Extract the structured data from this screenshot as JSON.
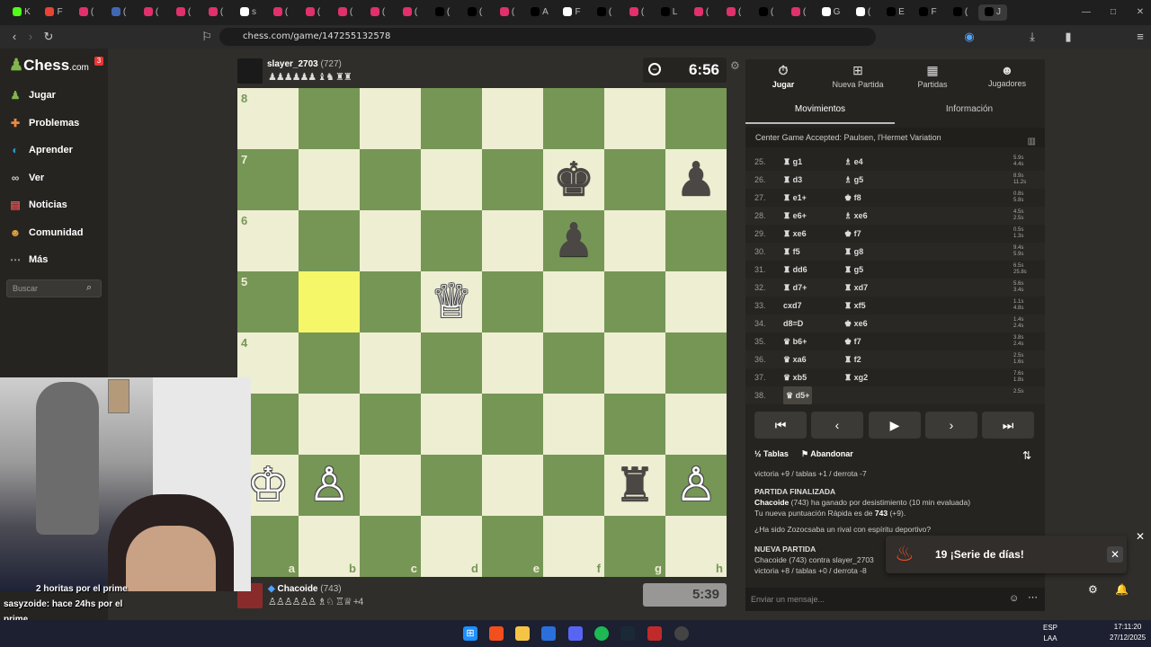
{
  "browser": {
    "url": "chess.com/game/147255132578",
    "tabs": [
      {
        "label": "K",
        "color": "#53fc18"
      },
      {
        "label": "F",
        "color": "#ea4335"
      },
      {
        "label": "(",
        "color": "#e1306c"
      },
      {
        "label": "(",
        "color": "#4267b2"
      },
      {
        "label": "(",
        "color": "#e1306c"
      },
      {
        "label": "(",
        "color": "#e1306c"
      },
      {
        "label": "(",
        "color": "#e1306c"
      },
      {
        "label": "s",
        "color": "#ffffff"
      },
      {
        "label": "(",
        "color": "#e1306c"
      },
      {
        "label": "(",
        "color": "#e1306c"
      },
      {
        "label": "(",
        "color": "#e1306c"
      },
      {
        "label": "(",
        "color": "#e1306c"
      },
      {
        "label": "(",
        "color": "#e1306c"
      },
      {
        "label": "(",
        "color": "#000000"
      },
      {
        "label": "(",
        "color": "#000000"
      },
      {
        "label": "(",
        "color": "#e1306c"
      },
      {
        "label": "A",
        "color": "#000000"
      },
      {
        "label": "F",
        "color": "#ffffff"
      },
      {
        "label": "(",
        "color": "#000000"
      },
      {
        "label": "(",
        "color": "#e1306c"
      },
      {
        "label": "L",
        "color": "#000000"
      },
      {
        "label": "(",
        "color": "#e1306c"
      },
      {
        "label": "(",
        "color": "#e1306c"
      },
      {
        "label": "(",
        "color": "#000000"
      },
      {
        "label": "(",
        "color": "#e1306c"
      },
      {
        "label": "G",
        "color": "#ffffff"
      },
      {
        "label": "(",
        "color": "#ffffff"
      },
      {
        "label": "E",
        "color": "#000000"
      },
      {
        "label": "F",
        "color": "#000000"
      },
      {
        "label": "(",
        "color": "#000000"
      },
      {
        "label": "J",
        "color": "#000000"
      }
    ]
  },
  "sidebar": {
    "logo": "Chess",
    "logo_suffix": ".com",
    "logo_badge": "3",
    "items": [
      {
        "label": "Jugar",
        "icon": "pawn-icon",
        "color": "#81b64c"
      },
      {
        "label": "Problemas",
        "icon": "puzzle-icon",
        "color": "#f0883a"
      },
      {
        "label": "Aprender",
        "icon": "learn-icon",
        "color": "#2d9ac9"
      },
      {
        "label": "Ver",
        "icon": "binoculars-icon",
        "color": "#cccccc"
      },
      {
        "label": "Noticias",
        "icon": "news-icon",
        "color": "#e05050"
      },
      {
        "label": "Comunidad",
        "icon": "community-icon",
        "color": "#e9a23b"
      },
      {
        "label": "Más",
        "icon": "more-icon",
        "color": "#999999"
      }
    ],
    "search_placeholder": "Buscar"
  },
  "top_player": {
    "name": "slayer_2703",
    "rating": "(727)",
    "captured": "♟♟♟♟♟♟ ♝♞ ♜♜",
    "clock": "6:56"
  },
  "bottom_player": {
    "name": "Chacoide",
    "rating": "(743)",
    "captured": "♙♙♙♙♙♙ ♗♘ ♖♕",
    "advantage": "+4",
    "clock": "5:39"
  },
  "board": {
    "highlight": [
      "b5"
    ],
    "pieces": [
      {
        "sq": "f7",
        "glyph": "♚",
        "color": "b"
      },
      {
        "sq": "h7",
        "glyph": "♟",
        "color": "b"
      },
      {
        "sq": "f6",
        "glyph": "♟",
        "color": "b"
      },
      {
        "sq": "d5",
        "glyph": "♕",
        "color": "w"
      },
      {
        "sq": "a2",
        "glyph": "♔",
        "color": "w"
      },
      {
        "sq": "b2",
        "glyph": "♙",
        "color": "w"
      },
      {
        "sq": "g2",
        "glyph": "♜",
        "color": "b"
      },
      {
        "sq": "h2",
        "glyph": "♙",
        "color": "w"
      }
    ],
    "ranks": [
      "8",
      "7",
      "6",
      "5",
      "4",
      "3",
      "2",
      "1"
    ],
    "files": [
      "a",
      "b",
      "c",
      "d",
      "e",
      "f",
      "g",
      "h"
    ]
  },
  "panel": {
    "tabs": [
      {
        "label": "Jugar",
        "icon": "stopwatch-icon"
      },
      {
        "label": "Nueva Partida",
        "icon": "plus-icon"
      },
      {
        "label": "Partidas",
        "icon": "board-icon"
      },
      {
        "label": "Jugadores",
        "icon": "players-icon"
      }
    ],
    "subtabs": [
      "Movimientos",
      "Información"
    ],
    "opening": "Center Game Accepted: Paulsen, l'Hermet Variation",
    "moves": [
      {
        "n": "25.",
        "w": "♜ g1",
        "b": "♗ e4",
        "t1": "5.9s",
        "t2": "4.4s"
      },
      {
        "n": "26.",
        "w": "♜ d3",
        "b": "♗ g5",
        "t1": "8.9s",
        "t2": "11.2s"
      },
      {
        "n": "27.",
        "w": "♜ e1+",
        "b": "♚ f8",
        "t1": "0.8s",
        "t2": "5.8s"
      },
      {
        "n": "28.",
        "w": "♜ e6+",
        "b": "♗ xe6",
        "t1": "4.5s",
        "t2": "2.5s"
      },
      {
        "n": "29.",
        "w": "♜ xe6",
        "b": "♚ f7",
        "t1": "0.5s",
        "t2": "1.3s"
      },
      {
        "n": "30.",
        "w": "♜ f5",
        "b": "♜ g8",
        "t1": "9.4s",
        "t2": "5.9s"
      },
      {
        "n": "31.",
        "w": "♜ dd6",
        "b": "♜ g5",
        "t1": "6.5s",
        "t2": "25.8s"
      },
      {
        "n": "32.",
        "w": "♜ d7+",
        "b": "♜ xd7",
        "t1": "5.6s",
        "t2": "3.4s"
      },
      {
        "n": "33.",
        "w": "cxd7",
        "b": "♜ xf5",
        "t1": "1.1s",
        "t2": "4.8s"
      },
      {
        "n": "34.",
        "w": "d8=D",
        "b": "♚ xe6",
        "t1": "1.4s",
        "t2": "2.4s"
      },
      {
        "n": "35.",
        "w": "♛ b6+",
        "b": "♚ f7",
        "t1": "3.8s",
        "t2": "2.4s"
      },
      {
        "n": "36.",
        "w": "♛ xa6",
        "b": "♜ f2",
        "t1": "2.5s",
        "t2": "1.6s"
      },
      {
        "n": "37.",
        "w": "♛ xb5",
        "b": "♜ xg2",
        "t1": "7.6s",
        "t2": "1.8s"
      },
      {
        "n": "38.",
        "w": "♛ d5+",
        "b": "",
        "t1": "2.5s",
        "t2": ""
      }
    ],
    "actions": {
      "draw": "Tablas",
      "resign": "Abandonar"
    },
    "chat": {
      "line1": "victoria +9 / tablas +1 / derrota -7",
      "finished_title": "PARTIDA FINALIZADA",
      "finished_player": "Chacoide",
      "finished_text": "(743) ha ganado por desistimiento (10 min evaluada)",
      "rating_text": "Tu nueva puntuación Rápida es de",
      "rating_value": "743",
      "rating_delta": "(+9).",
      "question": "¿Ha sido Zozocsaba un rival con espíritu deportivo?",
      "new_title": "NUEVA PARTIDA",
      "new_text": "Chacoide (743) contra slayer_2703",
      "line_last": "victoria +8 / tablas +0 / derrota -8",
      "placeholder": "Enviar un mensaje..."
    }
  },
  "toast": {
    "number": "19",
    "text": "¡Serie de días!"
  },
  "stream_chat": [
    {
      "user": "",
      "text": "2 horitas por el prime"
    },
    {
      "user": "sasyzoide:",
      "text": "hace 24hs por el"
    },
    {
      "user": "",
      "text": "prime"
    },
    {
      "user": "sasyzoide:",
      "text": ""
    }
  ],
  "taskbar": {
    "lang1": "ESP",
    "lang2": "LAA",
    "time": "17:11:20",
    "date": "27/12/2025"
  }
}
